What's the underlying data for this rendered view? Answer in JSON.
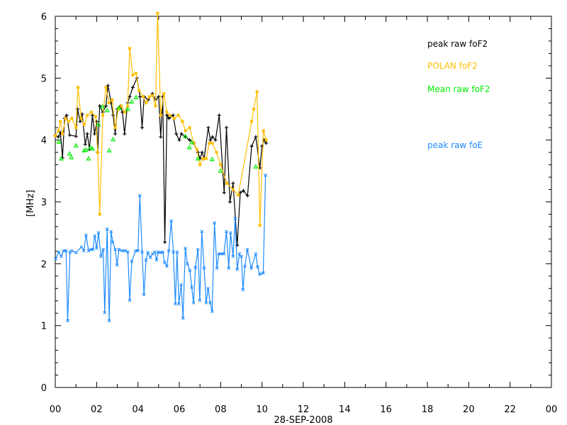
{
  "chart_data": {
    "type": "line",
    "title": "",
    "xlabel": "28-SEP-2008",
    "ylabel": "[MHz]",
    "xlim": [
      0,
      24
    ],
    "ylim": [
      0,
      6
    ],
    "x_ticks": [
      "00",
      "02",
      "04",
      "06",
      "08",
      "10",
      "12",
      "14",
      "16",
      "18",
      "20",
      "22",
      "00"
    ],
    "y_ticks": [
      "0",
      "1",
      "2",
      "3",
      "4",
      "5",
      "6"
    ],
    "legend_placement": "top-right",
    "series": [
      {
        "name": "peak raw foF2",
        "color": "#000000",
        "marker": "plus",
        "line": true,
        "points": [
          [
            0.0,
            4.07
          ],
          [
            0.15,
            4.05
          ],
          [
            0.25,
            4.12
          ],
          [
            0.35,
            3.71
          ],
          [
            0.45,
            4.35
          ],
          [
            0.55,
            4.4
          ],
          [
            0.7,
            4.08
          ],
          [
            1.0,
            4.06
          ],
          [
            1.08,
            4.5
          ],
          [
            1.2,
            4.3
          ],
          [
            1.3,
            4.42
          ],
          [
            1.45,
            3.93
          ],
          [
            1.55,
            4.1
          ],
          [
            1.65,
            3.85
          ],
          [
            1.8,
            4.4
          ],
          [
            1.9,
            4.1
          ],
          [
            2.0,
            4.3
          ],
          [
            2.05,
            3.8
          ],
          [
            2.15,
            4.55
          ],
          [
            2.3,
            4.45
          ],
          [
            2.45,
            4.55
          ],
          [
            2.55,
            4.88
          ],
          [
            2.7,
            4.6
          ],
          [
            2.8,
            4.4
          ],
          [
            2.9,
            4.1
          ],
          [
            3.0,
            4.5
          ],
          [
            3.15,
            4.55
          ],
          [
            3.25,
            4.45
          ],
          [
            3.35,
            4.1
          ],
          [
            3.5,
            4.6
          ],
          [
            3.6,
            4.7
          ],
          [
            3.75,
            4.85
          ],
          [
            3.95,
            5.0
          ],
          [
            4.1,
            4.7
          ],
          [
            4.2,
            4.2
          ],
          [
            4.3,
            4.7
          ],
          [
            4.5,
            4.65
          ],
          [
            4.7,
            4.75
          ],
          [
            4.85,
            4.65
          ],
          [
            5.0,
            4.7
          ],
          [
            5.1,
            4.05
          ],
          [
            5.2,
            4.7
          ],
          [
            5.3,
            2.35
          ],
          [
            5.4,
            4.4
          ],
          [
            5.5,
            4.35
          ],
          [
            5.7,
            4.4
          ],
          [
            5.85,
            4.1
          ],
          [
            6.0,
            4.0
          ],
          [
            6.1,
            4.1
          ],
          [
            6.3,
            4.05
          ],
          [
            6.5,
            4.0
          ],
          [
            6.7,
            3.95
          ],
          [
            6.9,
            3.8
          ],
          [
            7.0,
            3.7
          ],
          [
            7.1,
            3.8
          ],
          [
            7.2,
            3.7
          ],
          [
            7.4,
            4.2
          ],
          [
            7.5,
            4.0
          ],
          [
            7.6,
            4.05
          ],
          [
            7.75,
            4.0
          ],
          [
            7.93,
            4.4
          ],
          [
            8.17,
            3.15
          ],
          [
            8.28,
            4.2
          ],
          [
            8.45,
            3.0
          ],
          [
            8.6,
            3.3
          ],
          [
            8.8,
            2.3
          ],
          [
            8.95,
            3.15
          ],
          [
            9.1,
            3.18
          ],
          [
            9.3,
            3.1
          ],
          [
            9.5,
            3.9
          ],
          [
            9.7,
            4.05
          ],
          [
            9.9,
            3.55
          ],
          [
            10.0,
            3.9
          ],
          [
            10.1,
            4.0
          ],
          [
            10.2,
            3.95
          ]
        ]
      },
      {
        "name": "POLAN foF2",
        "color": "#ffbf00",
        "marker": "square",
        "line": true,
        "points": [
          [
            0.0,
            4.07
          ],
          [
            0.15,
            4.15
          ],
          [
            0.25,
            4.3
          ],
          [
            0.35,
            4.1
          ],
          [
            0.5,
            4.35
          ],
          [
            0.65,
            4.3
          ],
          [
            0.8,
            4.35
          ],
          [
            1.0,
            4.2
          ],
          [
            1.1,
            4.85
          ],
          [
            1.25,
            4.35
          ],
          [
            1.4,
            4.25
          ],
          [
            1.55,
            4.4
          ],
          [
            1.75,
            4.45
          ],
          [
            1.95,
            4.38
          ],
          [
            2.05,
            3.8
          ],
          [
            2.15,
            2.8
          ],
          [
            2.3,
            4.4
          ],
          [
            2.45,
            4.85
          ],
          [
            2.6,
            4.6
          ],
          [
            2.75,
            4.65
          ],
          [
            2.9,
            4.2
          ],
          [
            3.05,
            4.5
          ],
          [
            3.2,
            4.55
          ],
          [
            3.35,
            4.45
          ],
          [
            3.5,
            4.55
          ],
          [
            3.6,
            5.48
          ],
          [
            3.75,
            5.05
          ],
          [
            3.9,
            5.08
          ],
          [
            4.05,
            4.8
          ],
          [
            4.25,
            4.7
          ],
          [
            4.4,
            4.6
          ],
          [
            4.55,
            4.7
          ],
          [
            4.7,
            4.72
          ],
          [
            4.85,
            4.55
          ],
          [
            4.95,
            6.05
          ],
          [
            5.1,
            4.4
          ],
          [
            5.25,
            4.75
          ],
          [
            5.4,
            4.45
          ],
          [
            5.55,
            4.4
          ],
          [
            5.75,
            4.35
          ],
          [
            5.95,
            4.4
          ],
          [
            6.15,
            4.3
          ],
          [
            6.3,
            4.15
          ],
          [
            6.5,
            4.2
          ],
          [
            6.7,
            3.95
          ],
          [
            6.85,
            3.85
          ],
          [
            7.0,
            3.6
          ],
          [
            7.15,
            3.7
          ],
          [
            7.3,
            3.7
          ],
          [
            7.45,
            3.95
          ],
          [
            7.6,
            3.95
          ],
          [
            7.8,
            3.8
          ],
          [
            8.0,
            3.6
          ],
          [
            8.3,
            3.3
          ],
          [
            8.6,
            3.2
          ],
          [
            8.85,
            3.11
          ],
          [
            9.5,
            4.3
          ],
          [
            9.6,
            4.5
          ],
          [
            9.76,
            4.78
          ],
          [
            9.9,
            2.62
          ],
          [
            10.07,
            4.15
          ],
          [
            10.2,
            4.0
          ]
        ]
      },
      {
        "name": "Mean raw foF2",
        "color": "#00ee00",
        "marker": "triangle",
        "line": false,
        "points": [
          [
            0.17,
            3.97
          ],
          [
            0.29,
            3.7
          ],
          [
            0.69,
            3.78
          ],
          [
            0.78,
            3.72
          ],
          [
            1.0,
            3.91
          ],
          [
            1.4,
            3.83
          ],
          [
            1.49,
            3.84
          ],
          [
            1.61,
            3.7
          ],
          [
            1.7,
            3.88
          ],
          [
            1.8,
            3.86
          ],
          [
            2.09,
            4.25
          ],
          [
            2.28,
            4.54
          ],
          [
            2.51,
            4.48
          ],
          [
            2.61,
            3.83
          ],
          [
            2.8,
            4.01
          ],
          [
            3.08,
            4.52
          ],
          [
            3.51,
            4.5
          ],
          [
            3.7,
            4.62
          ],
          [
            3.91,
            4.69
          ],
          [
            6.29,
            4.06
          ],
          [
            6.49,
            3.88
          ],
          [
            6.6,
            3.96
          ],
          [
            6.9,
            3.7
          ],
          [
            7.59,
            3.69
          ],
          [
            7.99,
            3.5
          ],
          [
            9.7,
            3.57
          ]
        ]
      },
      {
        "name": "peak raw foE",
        "color": "#1e8cff",
        "marker": "cross",
        "line": true,
        "points": [
          [
            0.02,
            2.08
          ],
          [
            0.17,
            2.19
          ],
          [
            0.29,
            2.12
          ],
          [
            0.4,
            2.21
          ],
          [
            0.52,
            2.21
          ],
          [
            0.6,
            1.08
          ],
          [
            0.71,
            2.19
          ],
          [
            0.8,
            2.21
          ],
          [
            1.01,
            2.18
          ],
          [
            1.26,
            2.27
          ],
          [
            1.38,
            2.21
          ],
          [
            1.49,
            2.46
          ],
          [
            1.61,
            2.21
          ],
          [
            1.72,
            2.23
          ],
          [
            1.82,
            2.23
          ],
          [
            1.91,
            2.45
          ],
          [
            2.0,
            2.25
          ],
          [
            2.09,
            2.5
          ],
          [
            2.21,
            2.12
          ],
          [
            2.32,
            2.23
          ],
          [
            2.39,
            1.21
          ],
          [
            2.51,
            2.56
          ],
          [
            2.61,
            1.08
          ],
          [
            2.7,
            2.52
          ],
          [
            2.78,
            2.35
          ],
          [
            2.9,
            2.23
          ],
          [
            2.99,
            1.98
          ],
          [
            3.08,
            2.23
          ],
          [
            3.24,
            2.21
          ],
          [
            3.39,
            2.21
          ],
          [
            3.51,
            2.19
          ],
          [
            3.6,
            1.41
          ],
          [
            3.7,
            2.04
          ],
          [
            3.89,
            2.21
          ],
          [
            4.0,
            2.21
          ],
          [
            4.09,
            3.1
          ],
          [
            4.2,
            2.19
          ],
          [
            4.29,
            1.5
          ],
          [
            4.39,
            2.06
          ],
          [
            4.48,
            2.18
          ],
          [
            4.6,
            2.1
          ],
          [
            4.71,
            2.16
          ],
          [
            4.81,
            2.19
          ],
          [
            4.9,
            2.06
          ],
          [
            4.97,
            2.19
          ],
          [
            5.06,
            2.18
          ],
          [
            5.2,
            2.19
          ],
          [
            5.29,
            2.02
          ],
          [
            5.4,
            1.96
          ],
          [
            5.49,
            2.21
          ],
          [
            5.61,
            2.69
          ],
          [
            5.71,
            2.19
          ],
          [
            5.81,
            1.35
          ],
          [
            5.89,
            2.19
          ],
          [
            5.98,
            1.35
          ],
          [
            6.09,
            1.66
          ],
          [
            6.18,
            1.12
          ],
          [
            6.29,
            2.25
          ],
          [
            6.39,
            2.0
          ],
          [
            6.51,
            1.89
          ],
          [
            6.6,
            1.62
          ],
          [
            6.69,
            1.37
          ],
          [
            6.78,
            1.94
          ],
          [
            6.9,
            2.23
          ],
          [
            6.99,
            1.41
          ],
          [
            7.09,
            2.52
          ],
          [
            7.2,
            1.93
          ],
          [
            7.3,
            1.37
          ],
          [
            7.39,
            1.6
          ],
          [
            7.49,
            1.37
          ],
          [
            7.59,
            1.23
          ],
          [
            7.7,
            2.66
          ],
          [
            7.82,
            1.93
          ],
          [
            7.91,
            2.16
          ],
          [
            8.02,
            2.16
          ],
          [
            8.16,
            2.16
          ],
          [
            8.28,
            2.52
          ],
          [
            8.39,
            1.93
          ],
          [
            8.48,
            2.5
          ],
          [
            8.6,
            2.12
          ],
          [
            8.7,
            2.73
          ],
          [
            8.8,
            1.91
          ],
          [
            8.91,
            2.16
          ],
          [
            9.0,
            2.12
          ],
          [
            9.08,
            1.58
          ],
          [
            9.17,
            1.96
          ],
          [
            9.29,
            2.23
          ],
          [
            9.48,
            1.93
          ],
          [
            9.7,
            2.16
          ],
          [
            9.79,
            1.95
          ],
          [
            9.89,
            1.83
          ],
          [
            10.06,
            1.85
          ],
          [
            10.17,
            3.43
          ]
        ]
      }
    ]
  }
}
